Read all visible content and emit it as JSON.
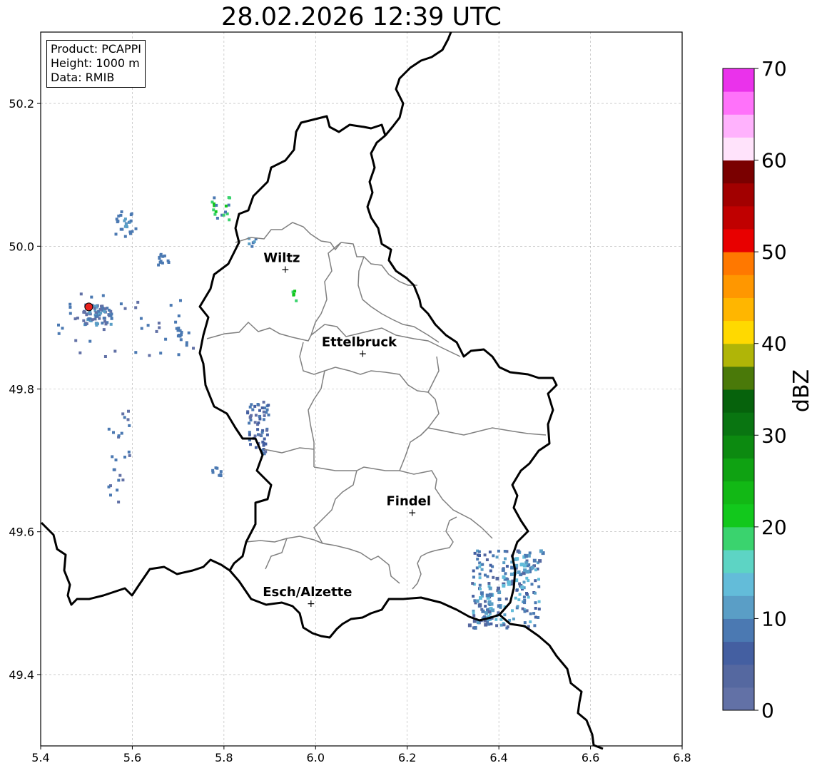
{
  "title": "28.02.2026 12:39 UTC",
  "info": {
    "product": "Product: PCAPPI",
    "height": "Height: 1000 m",
    "data": "Data: RMIB"
  },
  "map": {
    "lon_range": [
      5.4,
      6.8
    ],
    "lat_range": [
      49.3,
      50.3
    ],
    "x_ticks": [
      "5.4",
      "5.6",
      "5.8",
      "6.0",
      "6.2",
      "6.4",
      "6.6",
      "6.8"
    ],
    "y_ticks": [
      "50.2",
      "50.0",
      "49.8",
      "49.6",
      "49.4"
    ],
    "grid": true,
    "radar_site": {
      "lon": 5.505,
      "lat": 49.915,
      "color": "#e8221e"
    },
    "towns": [
      {
        "name": "Wiltz",
        "lon": 5.934,
        "lat": 49.968
      },
      {
        "name": "Ettelbruck",
        "lon": 6.103,
        "lat": 49.85
      },
      {
        "name": "Findel",
        "lon": 6.211,
        "lat": 49.627
      },
      {
        "name": "Esch/Alzette",
        "lon": 5.99,
        "lat": 49.5
      }
    ],
    "colors": {
      "border": "#000000",
      "district": "#808080",
      "grid": "#b0b0b0"
    }
  },
  "colorbar": {
    "label": "dBZ",
    "ticks": [
      "0",
      "10",
      "20",
      "30",
      "40",
      "50",
      "60",
      "70"
    ],
    "min": 0,
    "max": 70,
    "colors": [
      "#6271a6",
      "#5568a0",
      "#445fa1",
      "#4b79b2",
      "#5a9ec6",
      "#63bcd9",
      "#5dd4c4",
      "#3ad36e",
      "#12c81c",
      "#12b815",
      "#0fa212",
      "#0c8a10",
      "#097511",
      "#06620c",
      "#4a7909",
      "#b0b507",
      "#ffd900",
      "#ffb600",
      "#ff9700",
      "#ff7800",
      "#e80000",
      "#c00000",
      "#a20000",
      "#7a0000",
      "#ffe3fb",
      "#ffb2fd",
      "#ff72fa",
      "#ea32eb"
    ]
  }
}
